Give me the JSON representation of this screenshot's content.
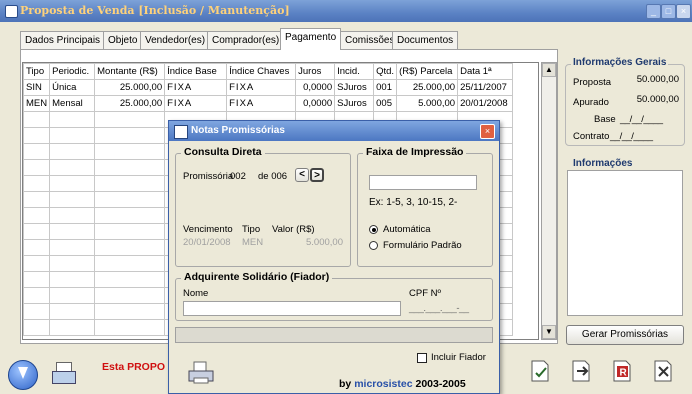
{
  "window": {
    "title": "Proposta de Venda [Inclusão / Manutenção]"
  },
  "tabs": [
    {
      "label": "Dados Principais"
    },
    {
      "label": "Objeto"
    },
    {
      "label": "Vendedor(es)"
    },
    {
      "label": "Comprador(es)"
    },
    {
      "label": "Pagamento"
    },
    {
      "label": "Comissões"
    },
    {
      "label": "Documentos"
    }
  ],
  "table": {
    "headers": [
      "Tipo",
      "Periodic.",
      "Montante (R$)",
      "Índice Base",
      "Índice Chaves",
      "Juros",
      "Incid.",
      "Qtd.",
      "(R$) Parcela",
      "Data 1ª"
    ],
    "rows": [
      [
        "SIN",
        "Única",
        "25.000,00",
        "FIXA",
        "FIXA",
        "0,0000",
        "SJuros",
        "001",
        "25.000,00",
        "25/11/2007"
      ],
      [
        "MEN",
        "Mensal",
        "25.000,00",
        "FIXA",
        "FIXA",
        "0,0000",
        "SJuros",
        "005",
        "5.000,00",
        "20/01/2008"
      ]
    ]
  },
  "info_gerais": {
    "title": "Informações Gerais",
    "proposta_label": "Proposta",
    "proposta_value": "50.000,00",
    "apurado_label": "Apurado",
    "apurado_value": "50.000,00",
    "base_label": "Base",
    "base_value": "__/__/____",
    "contrato_label": "Contrato",
    "contrato_value": "__/__/____"
  },
  "informacoes": {
    "title": "Informações"
  },
  "gerar_button": "Gerar Promissórias",
  "bottom": {
    "status_text": "Esta PROPO"
  },
  "dialog": {
    "title": "Notas Promissórias",
    "consulta": {
      "title": "Consulta Direta",
      "promissoria_label": "Promissória",
      "promissoria_value": "002",
      "de_label": "de 006",
      "prev": "<",
      "next": ">",
      "venc_label": "Vencimento",
      "tipo_label": "Tipo",
      "valor_label": "Valor (R$)",
      "venc_value": "20/01/2008",
      "tipo_value": "MEN",
      "valor_value": "5.000,00"
    },
    "faixa": {
      "title": "Faixa de Impressão",
      "example": "Ex: 1-5, 3, 10-15, 2-",
      "opt_auto": "Automática",
      "opt_padrao": "Formulário Padrão"
    },
    "adquirente": {
      "title": "Adquirente Solidário (Fiador)",
      "nome_label": "Nome",
      "cpf_label": "CPF Nº",
      "cpf_value": "___.___.___-__"
    },
    "incluir_fiador": "Incluir Fiador",
    "footer_by": "by",
    "footer_brand": "microsistec",
    "footer_years": "2003-2005"
  }
}
